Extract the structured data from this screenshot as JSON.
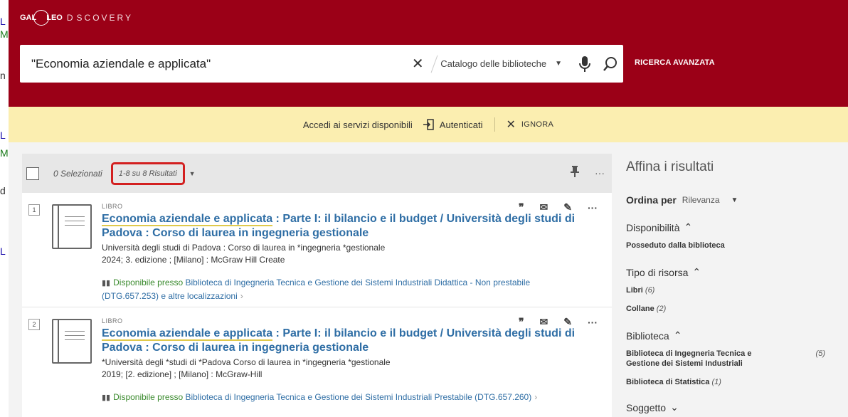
{
  "bleed": {
    "chars": [
      "L",
      "M",
      "n",
      "L",
      "M",
      "d",
      "L"
    ]
  },
  "header": {
    "logo_bold": "GAL",
    "logo_bold2": "LEO",
    "logo_rest": "D",
    "logo_rest2": "SCOVERY",
    "search_value": "\"Economia aziendale e applicata\"",
    "scope_label": "Catalogo delle biblioteche",
    "advanced_label": "RICERCA AVANZATA"
  },
  "banner": {
    "text": "Accedi ai servizi disponibili",
    "login_label": "Autenticati",
    "ignore_label": "IGNORA"
  },
  "toolbar": {
    "selected": "0 Selezionati",
    "results_count": "1-8 su 8 Risultati"
  },
  "records": [
    {
      "num": "1",
      "type": "LIBRO",
      "title_highlight": "Economia aziendale e applicata",
      "title_rest": " : Parte I: il bilancio e il budget / Università degli studi di Padova : Corso di laurea in ingegneria gestionale",
      "meta1": "Università degli studi di Padova : Corso di laurea in *ingegneria *gestionale",
      "meta2": "2024; 3. edizione ; [Milano] : McGraw Hill Create",
      "avail_prefix": "Disponibile presso",
      "avail_loc": "Biblioteca di Ingegneria Tecnica e Gestione dei Sistemi Industriali  Didattica - Non prestabile (DTG.657.253) e altre localizzazioni"
    },
    {
      "num": "2",
      "type": "LIBRO",
      "title_highlight": "Economia aziendale e applicata",
      "title_rest": " : Parte I: il bilancio e il budget / Università degli studi di Padova : Corso di laurea in ingegneria gestionale",
      "meta1": "*Università degli *studi di *Padova Corso di laurea in *ingegneria *gestionale",
      "meta2": "2019; [2. edizione] ; [Milano] : McGraw-Hill",
      "avail_prefix": "Disponibile presso",
      "avail_loc": "Biblioteca di Ingegneria Tecnica e Gestione dei Sistemi Industriali  Prestabile (DTG.657.260)"
    }
  ],
  "facets": {
    "title": "Affina i risultati",
    "sort_label": "Ordina per",
    "sort_value": "Rilevanza",
    "availability_head": "Disponibilità",
    "availability_item": "Posseduto dalla biblioteca",
    "type_head": "Tipo di risorsa",
    "type_items": [
      {
        "label": "Libri",
        "count": "(6)"
      },
      {
        "label": "Collane",
        "count": "(2)"
      }
    ],
    "library_head": "Biblioteca",
    "library_items": [
      {
        "label": "Biblioteca di Ingegneria Tecnica e Gestione dei Sistemi Industriali",
        "count": "(5)"
      },
      {
        "label": "Biblioteca di Statistica",
        "count": "(1)"
      }
    ],
    "subject_head": "Soggetto"
  }
}
